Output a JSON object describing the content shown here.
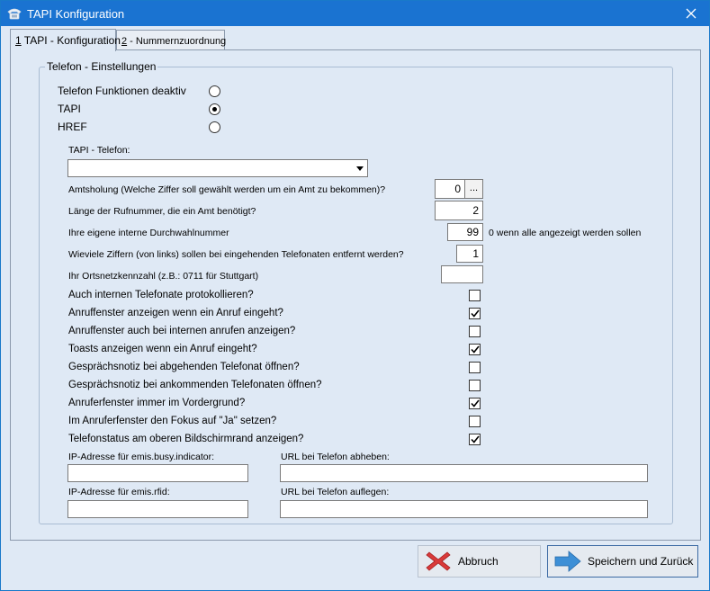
{
  "window": {
    "title": "TAPI Konfiguration"
  },
  "tabs": [
    {
      "key": "1",
      "label": " TAPI - Konfiguration"
    },
    {
      "key": "2",
      "label": " - Nummernzuordnung"
    }
  ],
  "group": {
    "legend": "Telefon - Einstellungen",
    "radios": [
      {
        "label": "Telefon Funktionen deaktiv",
        "selected": false
      },
      {
        "label": "TAPI",
        "selected": true
      },
      {
        "label": "HREF",
        "selected": false
      }
    ],
    "tapi_phone_label": "TAPI - Telefon:",
    "tapi_phone_value": "",
    "fields": {
      "amtsholung_label": "Amtsholung (Welche Ziffer soll gewählt werden um ein Amt zu bekommen)?",
      "amtsholung_value": "0",
      "amtsholung_button": "...",
      "rufnummer_len_label": "Länge der Rufnummer, die ein Amt benötigt?",
      "rufnummer_len_value": "2",
      "durchwahl_label": "Ihre eigene interne Durchwahlnummer",
      "durchwahl_value": "99",
      "durchwahl_hint": "0 wenn alle angezeigt werden sollen",
      "ziffern_label": "Wieviele Ziffern (von links) sollen bei eingehenden Telefonaten entfernt werden?",
      "ziffern_value": "1",
      "ortsnetz_label": "Ihr Ortsnetzkennzahl (z.B.: 0711 für Stuttgart)",
      "ortsnetz_value": ""
    },
    "checkboxes": [
      {
        "label": "Auch internen Telefonate protokollieren?",
        "checked": false
      },
      {
        "label": "Anruffenster anzeigen wenn ein Anruf eingeht?",
        "checked": true
      },
      {
        "label": "Anruffenster auch bei internen anrufen anzeigen?",
        "checked": false
      },
      {
        "label": "Toasts anzeigen wenn ein Anruf eingeht?",
        "checked": true
      },
      {
        "label": "Gesprächsnotiz bei abgehenden Telefonat öffnen?",
        "checked": false
      },
      {
        "label": "Gesprächsnotiz bei ankommenden Telefonaten öffnen?",
        "checked": false
      },
      {
        "label": "Anruferfenster immer im Vordergrund?",
        "checked": true
      },
      {
        "label": "Im Anruferfenster den Fokus auf \"Ja\" setzen?",
        "checked": false
      },
      {
        "label": "Telefonstatus am oberen Bildschirmrand anzeigen?",
        "checked": true
      }
    ],
    "ip_busy_label": "IP-Adresse für emis.busy.indicator:",
    "ip_busy_value": "",
    "url_abheben_label": "URL bei Telefon abheben:",
    "url_abheben_value": "",
    "ip_rfid_label": "IP-Adresse für emis.rfid:",
    "ip_rfid_value": "",
    "url_auflegen_label": "URL bei Telefon auflegen:",
    "url_auflegen_value": ""
  },
  "buttons": {
    "cancel_label": "Abbruch",
    "save_label": "Speichern und Zurück"
  },
  "icons": {
    "app": "telephone-icon",
    "close": "close-icon",
    "cancel": "red-x-icon",
    "save": "blue-arrow-icon",
    "dropdown": "chevron-down-icon",
    "check": "checkmark-icon"
  },
  "colors": {
    "titlebar": "#1a73d1",
    "background": "#dfe9f5",
    "cancel_icon": "#d93a3a",
    "save_icon": "#3d8fd6"
  }
}
